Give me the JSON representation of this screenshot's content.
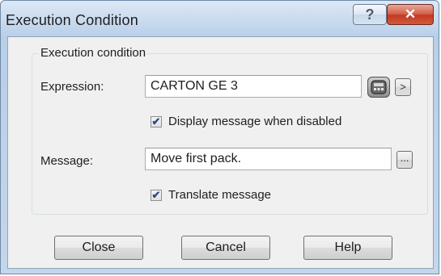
{
  "window": {
    "title": "Execution Condition",
    "help_glyph": "?",
    "close_glyph": "✕"
  },
  "group": {
    "legend": "Execution condition"
  },
  "expression": {
    "label": "Expression:",
    "value": "CARTON GE 3",
    "expand_glyph": ">",
    "edit_icon": "calculator-icon"
  },
  "display_message": {
    "label": "Display message when disabled",
    "checked": true
  },
  "message": {
    "label": "Message:",
    "value": "Move first pack.",
    "browse_glyph": "..."
  },
  "translate_message": {
    "label": "Translate message",
    "checked": true
  },
  "buttons": {
    "close": "Close",
    "cancel": "Cancel",
    "help": "Help"
  },
  "colors": {
    "title_bar": "#c7d9ee",
    "close_button": "#c23a22",
    "client_bg": "#f0f0f0"
  }
}
